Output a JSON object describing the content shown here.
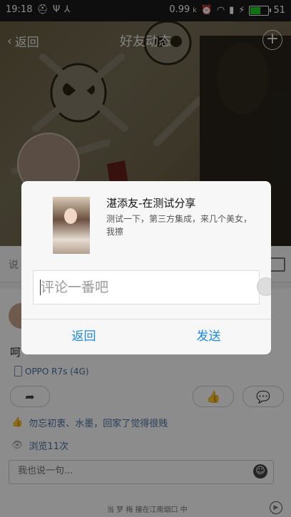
{
  "statusbar": {
    "time": "19:18",
    "left_icons": [
      "hat-icon",
      "usb-icon",
      "share-icon"
    ],
    "speed": "0.99",
    "speed_unit": "k",
    "battery": "51",
    "battery_level": 0.51,
    "right_icons": [
      "alarm-icon",
      "wifi-icon",
      "signal-icon",
      "charging-icon"
    ]
  },
  "nav": {
    "back_label": "返回",
    "title": "好友动态",
    "add_icon": "plus-circle-icon"
  },
  "say_bar": {
    "placeholder": "说"
  },
  "post": {
    "text": "呵",
    "device": "OPPO R7s (4G)",
    "likes_text": "勿忘初衷、水墨，回家了觉得很贱",
    "views_text": "浏览11次",
    "comment_placeholder": "我也说一句...",
    "share_icon": "share-arrow-icon",
    "like_icon": "thumbs-up-icon",
    "comment_icon": "comment-bubble-icon"
  },
  "bottom_strip": {
    "text": "当   梦  梅   撞在江南烟口  中"
  },
  "dialog": {
    "share_title": "湛添友-在测试分享",
    "share_desc": "测试一下，第三方集成，来几个美女，我擦",
    "input_placeholder": "评论一番吧",
    "back_button": "返回",
    "send_button": "发送"
  },
  "colors": {
    "accent": "#1e88e5",
    "link": "#4a6fa5",
    "battery_green": "#1fd21f"
  }
}
